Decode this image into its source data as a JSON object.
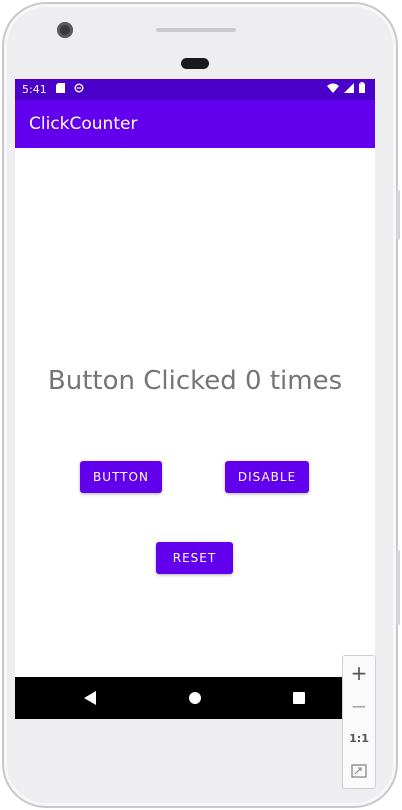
{
  "status_bar": {
    "time": "5:41",
    "icons": [
      "sd-card-icon",
      "data-saver-icon",
      "wifi-icon",
      "signal-icon",
      "battery-icon"
    ]
  },
  "app_bar": {
    "title": "ClickCounter"
  },
  "main": {
    "counter_text": "Button Clicked 0 times",
    "button_label": "BUTTON",
    "disable_label": "DISABLE",
    "reset_label": "RESET"
  },
  "nav_bar": {
    "icons": [
      "back-icon",
      "home-icon",
      "recents-icon"
    ]
  },
  "emulator_zoom": {
    "zoom_in": "+",
    "zoom_out": "−",
    "actual_size": "1:1",
    "fit_icon": "fit-screen-icon"
  },
  "colors": {
    "status_bar": "#4b00c9",
    "primary": "#6200ee",
    "counter_text": "#757575",
    "nav_bar": "#000000"
  }
}
